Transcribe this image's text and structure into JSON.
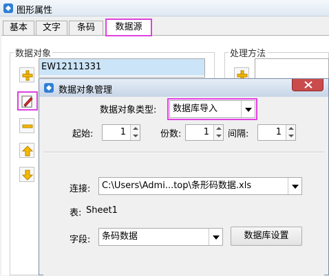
{
  "window": {
    "title": "图形属性"
  },
  "tabs": [
    {
      "label": "基本"
    },
    {
      "label": "文字"
    },
    {
      "label": "条码"
    },
    {
      "label": "数据源"
    }
  ],
  "data_object": {
    "group_label": "数据对象",
    "items": [
      "EW12111331"
    ]
  },
  "processing": {
    "group_label": "处理方法"
  },
  "dialog": {
    "title": "数据对象管理",
    "type_label": "数据对象类型:",
    "type_value": "数据库导入",
    "start_label": "起始:",
    "start_value": "1",
    "copies_label": "份数:",
    "copies_value": "1",
    "interval_label": "间隔:",
    "interval_value": "1",
    "connection_label": "连接:",
    "connection_value": "C:\\Users\\Admi...top\\条形码数据.xls",
    "table_label": "表:",
    "table_value": "Sheet1",
    "field_label": "字段:",
    "field_value": "条码数据",
    "db_settings_button": "数据库设置"
  },
  "colors": {
    "highlight": "#e040e0",
    "icon_yellow": "#f5b800",
    "selection": "#cce4f7",
    "close_red": "#c94b4b"
  }
}
